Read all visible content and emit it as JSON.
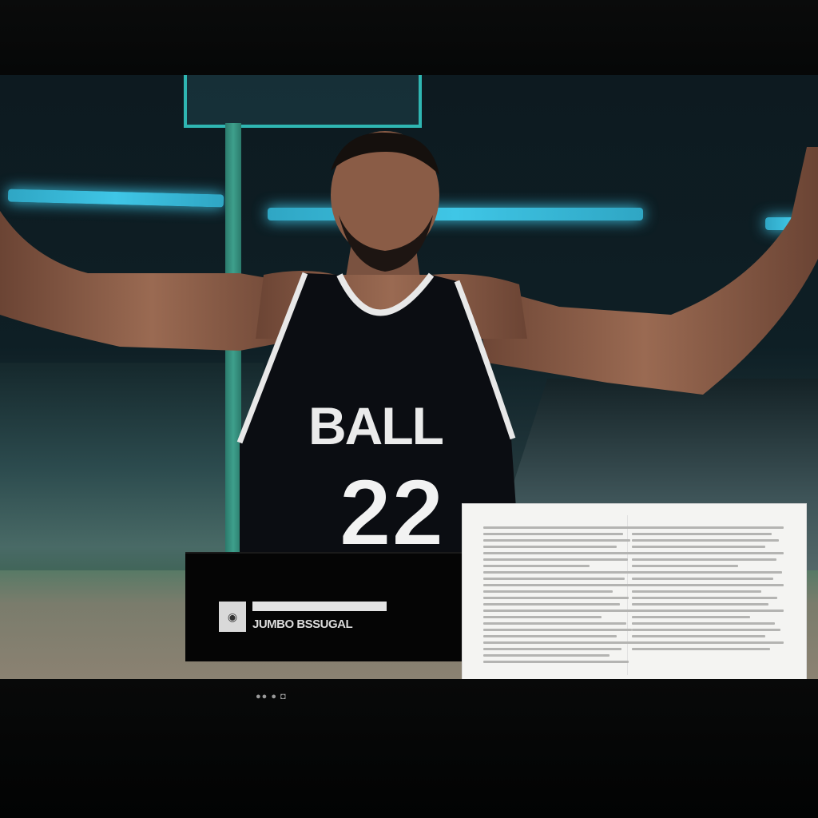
{
  "video": {
    "jersey_text": "BALL",
    "jersey_number": "22"
  },
  "caption": {
    "thumbnail_glyph": "◉",
    "text": "JUMBO BSSUGAL"
  },
  "document_panel": {
    "left_lines": 22,
    "right_lines": 20
  },
  "status": {
    "indicators": "●● ● ◘"
  },
  "colors": {
    "accent_light": "#3fc6e6",
    "jersey": "#0b0d12",
    "jersey_trim": "#e8e8e8"
  }
}
